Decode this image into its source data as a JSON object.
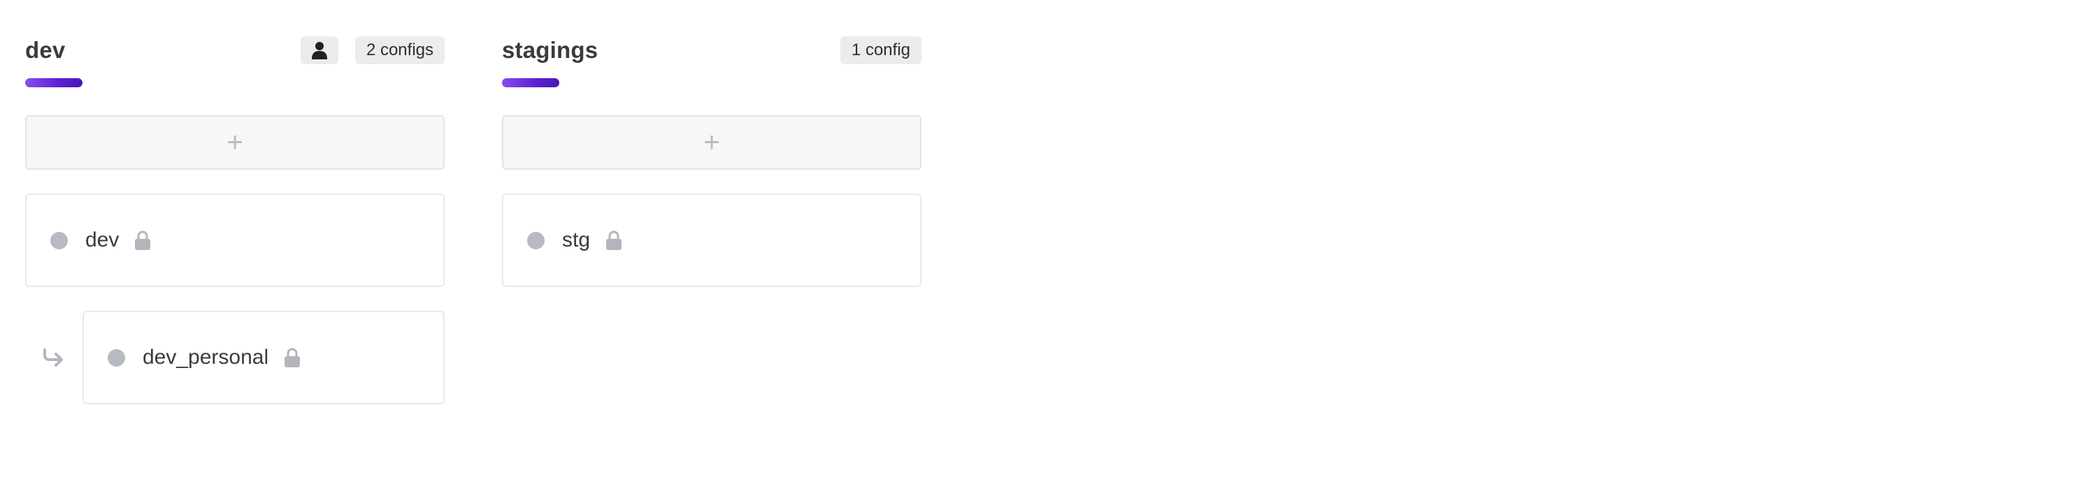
{
  "columns": [
    {
      "title": "dev",
      "count_label": "2 configs",
      "has_user_badge": true,
      "add_label": "+",
      "configs": [
        {
          "name": "dev",
          "locked": true
        },
        {
          "name": "dev_personal",
          "locked": true,
          "branched": true
        }
      ]
    },
    {
      "title": "stagings",
      "count_label": "1 config",
      "has_user_badge": false,
      "add_label": "+",
      "configs": [
        {
          "name": "stg",
          "locked": true
        }
      ]
    }
  ],
  "icons": {
    "user": "user-icon",
    "lock": "lock-icon",
    "branch": "branch-arrow-icon",
    "add": "plus-icon"
  },
  "colors": {
    "accent_start": "#8a4bf0",
    "accent_end": "#4b16b8",
    "dot": "#b8bac3"
  }
}
